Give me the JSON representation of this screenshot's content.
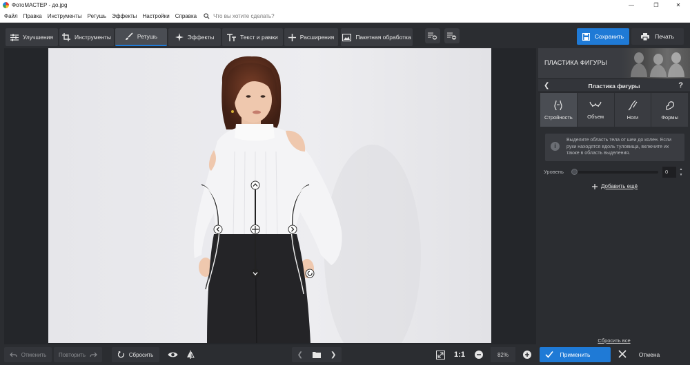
{
  "titlebar": {
    "title": "ФотоМАСТЕР - до.jpg",
    "minimize": "—",
    "maximize": "❐",
    "close": "✕"
  },
  "menu": {
    "items": [
      "Файл",
      "Правка",
      "Инструменты",
      "Ретушь",
      "Эффекты",
      "Настройки",
      "Справка"
    ],
    "search_placeholder": "Что вы хотите сделать?"
  },
  "toolbar": {
    "tabs": [
      {
        "label": "Улучшения",
        "icon": "sliders-icon"
      },
      {
        "label": "Инструменты",
        "icon": "crop-icon"
      },
      {
        "label": "Ретушь",
        "icon": "brush-icon",
        "active": true
      },
      {
        "label": "Эффекты",
        "icon": "sparkle-icon"
      },
      {
        "label": "Текст и рамки",
        "icon": "text-icon"
      },
      {
        "label": "Расширения",
        "icon": "plus-icon"
      },
      {
        "label": "Пакетная обработка",
        "icon": "images-icon"
      }
    ],
    "save_label": "Сохранить",
    "print_label": "Печать"
  },
  "panel": {
    "banner_title": "ПЛАСТИКА ФИГУРЫ",
    "subheader_title": "Пластика фигуры",
    "help": "?",
    "tabs": [
      {
        "label": "Стройность",
        "icon": "body-slim-icon",
        "active": true
      },
      {
        "label": "Объем",
        "icon": "chest-icon"
      },
      {
        "label": "Ноги",
        "icon": "legs-icon"
      },
      {
        "label": "Формы",
        "icon": "shape-icon"
      }
    ],
    "info_icon": "i",
    "info_text": "Выделите область тела от шеи до колен. Если руки находятся вдоль туловища, включите их также в область выделения.",
    "level_label": "Уровень",
    "level_value": "0",
    "add_more": "Добавить ещё",
    "reset_all": "Сбросить все"
  },
  "bottom": {
    "undo": "Отменить",
    "redo": "Повторить",
    "reset": "Сбросить",
    "zoom_1to1": "1:1",
    "zoom_percent": "82%",
    "apply": "Применить",
    "cancel": "Отмена"
  },
  "colors": {
    "accent": "#1f7ad6",
    "background": "#2b2d31",
    "panel_button": "#3a3c41"
  }
}
